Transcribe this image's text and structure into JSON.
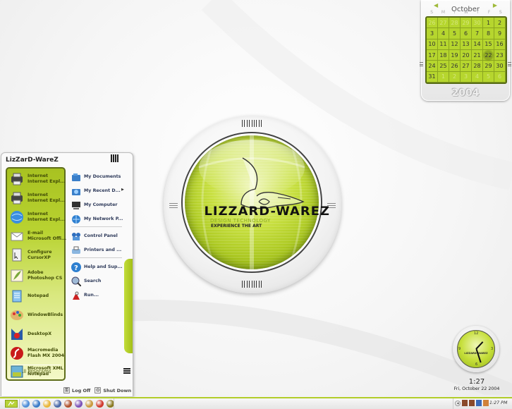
{
  "calendar": {
    "month": "October",
    "year": "2004",
    "weekdays": [
      "S",
      "M",
      "T",
      "W",
      "T",
      "F",
      "S"
    ],
    "days": [
      {
        "d": "26",
        "other": true
      },
      {
        "d": "27",
        "other": true
      },
      {
        "d": "28",
        "other": true
      },
      {
        "d": "29",
        "other": true
      },
      {
        "d": "30",
        "other": true
      },
      {
        "d": "1"
      },
      {
        "d": "2"
      },
      {
        "d": "3"
      },
      {
        "d": "4"
      },
      {
        "d": "5"
      },
      {
        "d": "6"
      },
      {
        "d": "7"
      },
      {
        "d": "8"
      },
      {
        "d": "9"
      },
      {
        "d": "10"
      },
      {
        "d": "11"
      },
      {
        "d": "12"
      },
      {
        "d": "13"
      },
      {
        "d": "14"
      },
      {
        "d": "15"
      },
      {
        "d": "16"
      },
      {
        "d": "17"
      },
      {
        "d": "18"
      },
      {
        "d": "19"
      },
      {
        "d": "20"
      },
      {
        "d": "21"
      },
      {
        "d": "22",
        "today": true
      },
      {
        "d": "23"
      },
      {
        "d": "24"
      },
      {
        "d": "25"
      },
      {
        "d": "26"
      },
      {
        "d": "27"
      },
      {
        "d": "28"
      },
      {
        "d": "29"
      },
      {
        "d": "30"
      },
      {
        "d": "31"
      },
      {
        "d": "1",
        "other": true
      },
      {
        "d": "2",
        "other": true
      },
      {
        "d": "3",
        "other": true
      },
      {
        "d": "4",
        "other": true
      },
      {
        "d": "5",
        "other": true
      },
      {
        "d": "6",
        "other": true
      }
    ],
    "prev_icon": "triangle-left-icon",
    "next_icon": "triangle-right-icon"
  },
  "logo": {
    "title": "LIZZARD-WAREZ",
    "subtitle": "DESIGN TECHNOLOGY",
    "tagline": "EXPERIENCE THE ART"
  },
  "start_menu": {
    "user": "LizZarD-WareZ",
    "pinned": [
      {
        "line1": "Internet",
        "line2": "Internet Expl...",
        "icon": "printer-icon"
      },
      {
        "line1": "Internet",
        "line2": "Internet Expl...",
        "icon": "printer-icon"
      },
      {
        "line1": "Internet",
        "line2": "Internet Expl...",
        "icon": "globe-icon"
      },
      {
        "line1": "E-mail",
        "line2": "Microsoft Offi...",
        "icon": "envelope-icon"
      }
    ],
    "recent": [
      {
        "line1": "Configure",
        "line2": "CursorXP",
        "icon": "cursor-doc-icon"
      },
      {
        "line1": "Adobe",
        "line2": "Photoshop CS",
        "icon": "feather-icon"
      },
      {
        "line1": "Notepad",
        "line2": "",
        "icon": "notepad-icon"
      },
      {
        "line1": "WindowBlinds",
        "line2": "",
        "icon": "palette-icon"
      },
      {
        "line1": "DesktopX",
        "line2": "",
        "icon": "desktopx-icon"
      },
      {
        "line1": "Macromedia",
        "line2": "Flash MX 2004",
        "icon": "flash-icon"
      },
      {
        "line1": "Microsoft XML",
        "line2": "Notepad",
        "icon": "xml-notepad-icon"
      }
    ],
    "all_programs": "All Programs",
    "places": [
      {
        "label": "My Documents",
        "icon": "folder-docs-icon"
      },
      {
        "label": "My Recent D...",
        "icon": "folder-recent-icon",
        "submenu": true
      },
      {
        "label": "My Computer",
        "icon": "computer-icon"
      },
      {
        "label": "My Network P...",
        "icon": "network-icon"
      },
      {
        "label": "Control Panel",
        "icon": "control-panel-icon"
      },
      {
        "label": "Printers and ...",
        "icon": "printer-fax-icon"
      },
      {
        "label": "Help and Sup...",
        "icon": "help-icon"
      },
      {
        "label": "Search",
        "icon": "search-icon"
      },
      {
        "label": "Run...",
        "icon": "run-icon"
      }
    ],
    "log_off": "Log Off",
    "shut_down": "Shut Down"
  },
  "clock": {
    "time": "1:27",
    "date": "Fri, October 22 2004",
    "numbers": [
      "12",
      "3",
      "6",
      "9"
    ],
    "brand": "LIZZARD-WAREZ",
    "hour": 1,
    "minute": 27
  },
  "taskbar": {
    "quick_launch": [
      {
        "name": "ql-messenger-icon",
        "color": "#4f8fd8"
      },
      {
        "name": "ql-ie-icon",
        "color": "#3a7bc8"
      },
      {
        "name": "ql-app-icon",
        "color": "#e9b63a"
      },
      {
        "name": "ql-firefox-icon",
        "color": "#4a6aa8"
      },
      {
        "name": "ql-browser-icon",
        "color": "#b0522c"
      },
      {
        "name": "ql-purple-icon",
        "color": "#7b52b8"
      },
      {
        "name": "ql-tool-icon",
        "color": "#c99a3e"
      },
      {
        "name": "ql-red-icon",
        "color": "#d03a2e"
      },
      {
        "name": "ql-olive-icon",
        "color": "#8a7a20"
      }
    ],
    "tray_icons": [
      {
        "name": "tray-network-icon",
        "color": "#8a4a2a"
      },
      {
        "name": "tray-network2-icon",
        "color": "#8a4a2a"
      },
      {
        "name": "tray-monitor-icon",
        "color": "#3a6ab8"
      },
      {
        "name": "tray-app-icon",
        "color": "#d0823a"
      }
    ],
    "time": "1:27 PM",
    "accent": "#b2cd2a"
  }
}
